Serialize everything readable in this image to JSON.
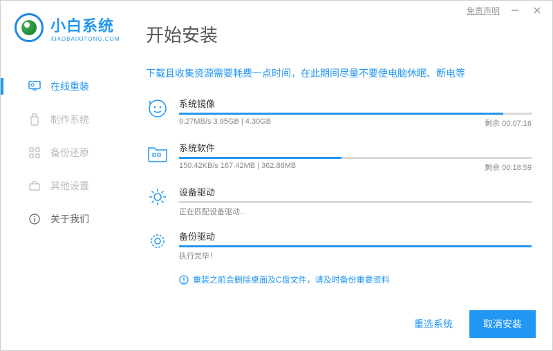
{
  "titlebar": {
    "disclaimer": "免责声明"
  },
  "logo": {
    "title": "小白系统",
    "subtitle": "XIAOBAIXITONG.COM"
  },
  "page_title": "开始安装",
  "sidebar": {
    "items": [
      {
        "label": "在线重装",
        "active": true
      },
      {
        "label": "制作系统",
        "active": false
      },
      {
        "label": "备份还原",
        "active": false
      },
      {
        "label": "其他设置",
        "active": false
      },
      {
        "label": "关于我们",
        "active": false
      }
    ]
  },
  "info_text": "下载且收集资源需要耗费一点时间，在此期间尽量不要使电脑休眠、断电等",
  "tasks": [
    {
      "title": "系统镜像",
      "detail": "9.27MB/s 3.95GB | 4.30GB",
      "remain": "剩余 00:07:16",
      "progress": 92
    },
    {
      "title": "系统软件",
      "detail": "150.42KB/s 167.42MB | 362.88MB",
      "remain": "剩余 00:18:59",
      "progress": 46
    },
    {
      "title": "设备驱动",
      "status": "正在匹配设备驱动...",
      "progress": 0
    },
    {
      "title": "备份驱动",
      "status": "执行完毕！",
      "progress": 100
    }
  ],
  "warning": "重装之前会删除桌面及C盘文件，请及时备份重要资料",
  "footer": {
    "reselect": "重选系统",
    "cancel": "取消安装"
  }
}
